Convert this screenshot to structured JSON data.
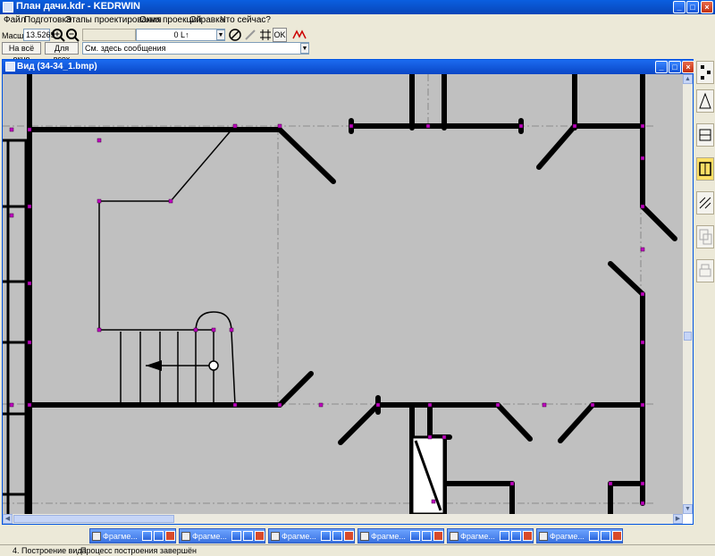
{
  "app": {
    "title": "План дачи.kdr - KEDRWIN",
    "title_bar_color": "#0a55d8"
  },
  "menu": [
    "Файл",
    "Подготовка",
    "Этапы проектирования",
    "Окна проекций",
    "Справка",
    "Что сейчас?"
  ],
  "toolbar": {
    "scale_label": "Масшт",
    "scale_value": "13.5269",
    "fit_all_label": "На всё окно",
    "for_all_label": "Для всех",
    "layer_value": "0 L↑",
    "ok_label": "OK",
    "message_placeholder": "См. здесь сообщения"
  },
  "view_window": {
    "title": "Вид (34-34_1.bmp)",
    "canvas_color": "#c0c0c0",
    "wall_color": "#000000",
    "node_color": "#c000c0"
  },
  "right_panel": {
    "icons": [
      "structure-icon",
      "elevation-icon",
      "section-icon",
      "plan-active-icon",
      "hatch-icon",
      "copy-icon",
      "print-icon"
    ]
  },
  "taskbar": {
    "items": [
      "Фрагме...",
      "Фрагме...",
      "Фрагме...",
      "Фрагме...",
      "Фрагме...",
      "Фрагме..."
    ]
  },
  "status": {
    "step": "4. Построение вида",
    "message": "Процесс построения завершён"
  }
}
